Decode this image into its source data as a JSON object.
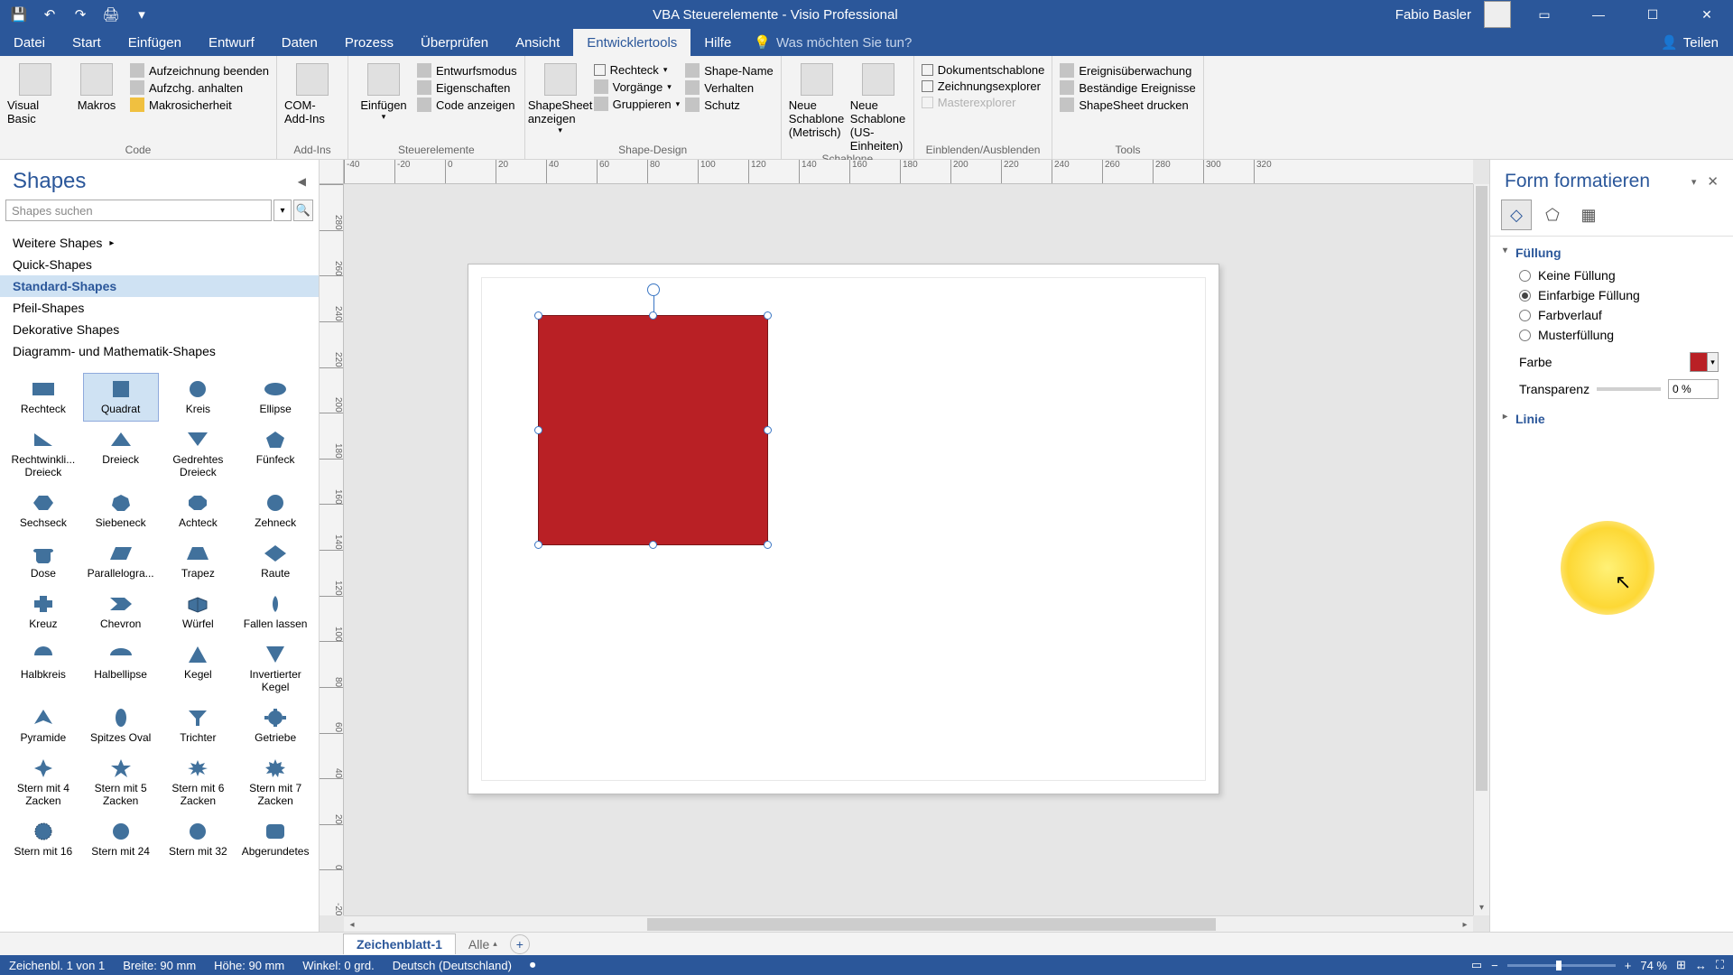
{
  "title": "VBA Steuerelemente - Visio Professional",
  "user": "Fabio Basler",
  "share": "Teilen",
  "qat": {
    "save": "💾",
    "undo": "↶",
    "redo": "↷",
    "print": "🖨",
    "more": "▾"
  },
  "tabs": [
    "Datei",
    "Start",
    "Einfügen",
    "Entwurf",
    "Daten",
    "Prozess",
    "Überprüfen",
    "Ansicht",
    "Entwicklertools",
    "Hilfe"
  ],
  "active_tab": 8,
  "tell_me": "Was möchten Sie tun?",
  "ribbon": {
    "code": {
      "label": "Code",
      "visualbasic": "Visual Basic",
      "makros": "Makros",
      "rec_stop": "Aufzeichnung beenden",
      "rec_pause": "Aufzchg. anhalten",
      "makrosec": "Makrosicherheit"
    },
    "addins": {
      "label": "Add-Ins",
      "com": "COM-Add-Ins"
    },
    "steuer": {
      "label": "Steuerelemente",
      "einf": "Einfügen",
      "entwurf": "Entwurfsmodus",
      "eigen": "Eigenschaften",
      "code": "Code anzeigen"
    },
    "design": {
      "label": "Shape-Design",
      "shapesheet": "ShapeSheet anzeigen",
      "rechteck": "Rechteck",
      "vorg": "Vorgänge",
      "grupp": "Gruppieren",
      "shapename": "Shape-Name",
      "verhalten": "Verhalten",
      "schutz": "Schutz"
    },
    "schablone": {
      "label": "Schablone",
      "neu_m": "Neue Schablone (Metrisch)",
      "neu_u": "Neue Schablone (US-Einheiten)"
    },
    "einaus": {
      "label": "Einblenden/Ausblenden",
      "dok": "Dokumentschablone",
      "zexp": "Zeichnungsexplorer",
      "mexp": "Masterexplorer"
    },
    "tools": {
      "label": "Tools",
      "ereig": "Ereignisüberwachung",
      "best": "Beständige Ereignisse",
      "print": "ShapeSheet drucken"
    }
  },
  "shapes_pane": {
    "title": "Shapes",
    "search_placeholder": "Shapes suchen",
    "categories": [
      {
        "label": "Weitere Shapes",
        "arrow": true
      },
      {
        "label": "Quick-Shapes"
      },
      {
        "label": "Standard-Shapes",
        "active": true
      },
      {
        "label": "Pfeil-Shapes"
      },
      {
        "label": "Dekorative Shapes"
      },
      {
        "label": "Diagramm- und Mathematik-Shapes"
      }
    ],
    "shapes": [
      "Rechteck",
      "Quadrat",
      "Kreis",
      "Ellipse",
      "Rechtwinkli... Dreieck",
      "Dreieck",
      "Gedrehtes Dreieck",
      "Fünfeck",
      "Sechseck",
      "Siebeneck",
      "Achteck",
      "Zehneck",
      "Dose",
      "Parallelogra...",
      "Trapez",
      "Raute",
      "Kreuz",
      "Chevron",
      "Würfel",
      "Fallen lassen",
      "Halbkreis",
      "Halbellipse",
      "Kegel",
      "Invertierter Kegel",
      "Pyramide",
      "Spitzes Oval",
      "Trichter",
      "Getriebe",
      "Stern mit 4 Zacken",
      "Stern mit 5 Zacken",
      "Stern mit 6 Zacken",
      "Stern mit 7 Zacken",
      "Stern mit 16",
      "Stern mit 24",
      "Stern mit 32",
      "Abgerundetes"
    ],
    "selected_shape": 1
  },
  "h_ticks": [
    "-40",
    "-20",
    "0",
    "20",
    "40",
    "60",
    "80",
    "100",
    "120",
    "140",
    "160",
    "180",
    "200",
    "220",
    "240",
    "260",
    "280",
    "300",
    "320"
  ],
  "v_ticks": [
    "280",
    "260",
    "240",
    "220",
    "200",
    "180",
    "160",
    "140",
    "120",
    "100",
    "80",
    "60",
    "40",
    "20",
    "0",
    "-20"
  ],
  "format_pane": {
    "title": "Form formatieren",
    "sect_fill": "Füllung",
    "sect_line": "Linie",
    "fills": [
      "Keine Füllung",
      "Einfarbige Füllung",
      "Farbverlauf",
      "Musterfüllung"
    ],
    "fill_selected": 1,
    "color_label": "Farbe",
    "transp_label": "Transparenz",
    "transp_val": "0 %"
  },
  "page_tabs": {
    "sheet": "Zeichenblatt-1",
    "all": "Alle",
    "add": "+"
  },
  "status": {
    "page": "Zeichenbl. 1 von 1",
    "width": "Breite: 90 mm",
    "height": "Höhe: 90 mm",
    "angle": "Winkel: 0 grd.",
    "lang": "Deutsch (Deutschland)",
    "rec": "⏺",
    "zoom": "74 %"
  }
}
